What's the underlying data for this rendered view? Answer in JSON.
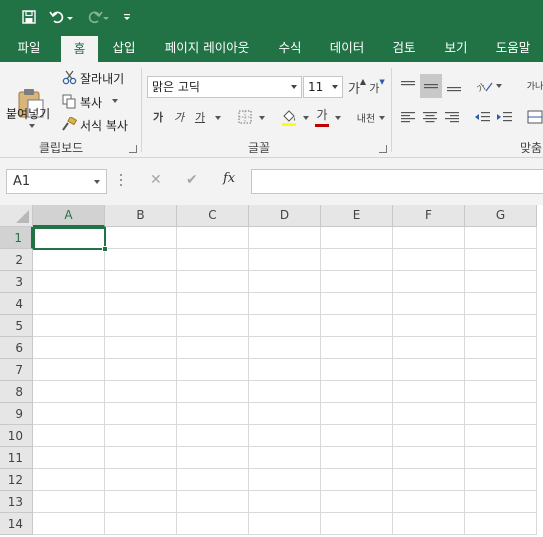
{
  "quick_access": {
    "save_icon": "save-icon",
    "undo_icon": "undo-icon",
    "redo_icon": "redo-icon",
    "customize_icon": "customize-qat-icon"
  },
  "tabs": [
    {
      "label": "파일"
    },
    {
      "label": "홈",
      "active": true
    },
    {
      "label": "삽입"
    },
    {
      "label": "페이지 레이아웃"
    },
    {
      "label": "수식"
    },
    {
      "label": "데이터"
    },
    {
      "label": "검토"
    },
    {
      "label": "보기"
    },
    {
      "label": "도움말"
    }
  ],
  "ribbon": {
    "clipboard": {
      "paste_label": "붙여넣기",
      "cut_label": "잘라내기",
      "copy_label": "복사",
      "format_painter_label": "서식 복사",
      "group_label": "클립보드"
    },
    "font": {
      "font_name": "맑은 고딕",
      "font_size": "11",
      "grow_label": "가",
      "shrink_label": "가",
      "bold_label": "가",
      "italic_label": "가",
      "underline_label": "가",
      "font_color_label": "가",
      "phonetic_label": "내천",
      "group_label": "글꼴"
    },
    "alignment": {
      "wrap_label": "가나",
      "group_label": "맞춤"
    }
  },
  "formula_bar": {
    "name_box": "A1",
    "cancel_symbol": "✕",
    "enter_symbol": "✔",
    "fx_label": "fx",
    "formula_value": ""
  },
  "sheet": {
    "columns": [
      "A",
      "B",
      "C",
      "D",
      "E",
      "F",
      "G"
    ],
    "rows": [
      "1",
      "2",
      "3",
      "4",
      "5",
      "6",
      "7",
      "8",
      "9",
      "10",
      "11",
      "12",
      "13",
      "14"
    ],
    "active_cell": "A1"
  },
  "colors": {
    "accent": "#217346",
    "ribbon_bg": "#f3f3f3",
    "header_bg": "#e6e6e6",
    "gridline": "#d9d9d9"
  }
}
